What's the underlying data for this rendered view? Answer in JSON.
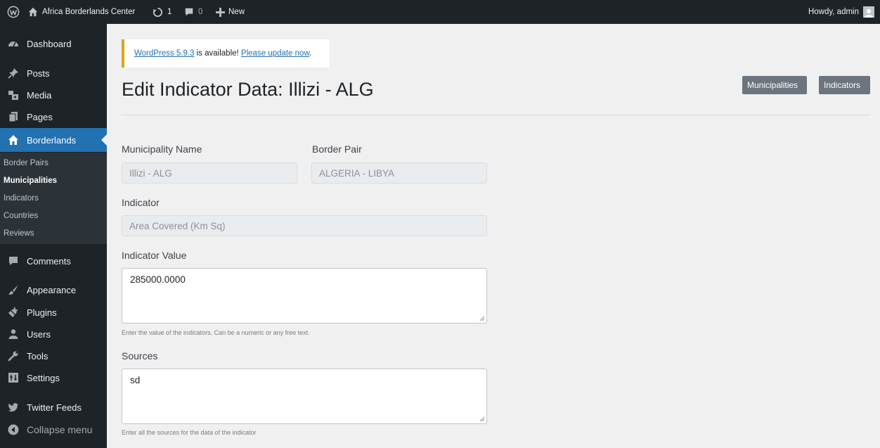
{
  "admin_bar": {
    "site_name": "Africa Borderlands Center",
    "updates_count": "1",
    "comments_count": "0",
    "new_label": "New",
    "howdy": "Howdy, admin"
  },
  "menu": {
    "dashboard": "Dashboard",
    "posts": "Posts",
    "media": "Media",
    "pages": "Pages",
    "borderlands": "Borderlands",
    "submenu": {
      "border_pairs": "Border Pairs",
      "municipalities": "Municipalities",
      "indicators": "Indicators",
      "countries": "Countries",
      "reviews": "Reviews"
    },
    "comments": "Comments",
    "appearance": "Appearance",
    "plugins": "Plugins",
    "users": "Users",
    "tools": "Tools",
    "settings": "Settings",
    "twitter_feeds": "Twitter Feeds",
    "collapse": "Collapse menu"
  },
  "notice": {
    "version_link": "WordPress 5.9.3",
    "middle_text": " is available! ",
    "update_link": "Please update now",
    "end_text": "."
  },
  "page": {
    "title": "Edit Indicator Data: Illizi - ALG",
    "btn_municipalities": "Municipalities",
    "btn_indicators": "Indicators"
  },
  "form": {
    "municipality_label": "Municipality Name",
    "municipality_value": "Illizi - ALG",
    "border_pair_label": "Border Pair",
    "border_pair_value": "ALGERIA - LIBYA",
    "indicator_label": "Indicator",
    "indicator_value": "Area Covered (Km Sq)",
    "indicator_value_label": "Indicator Value",
    "indicator_value_text": "285000.0000",
    "indicator_value_help": "Enter the value of the indicators. Can be a numeric or any free text.",
    "sources_label": "Sources",
    "sources_text": "sd",
    "sources_help": "Enter all the sources for the data of the indicator"
  },
  "colors": {
    "admin_bg": "#1d2327",
    "current_menu": "#2271b1",
    "notice_border": "#dba617",
    "secondary_button": "#6c757d"
  }
}
